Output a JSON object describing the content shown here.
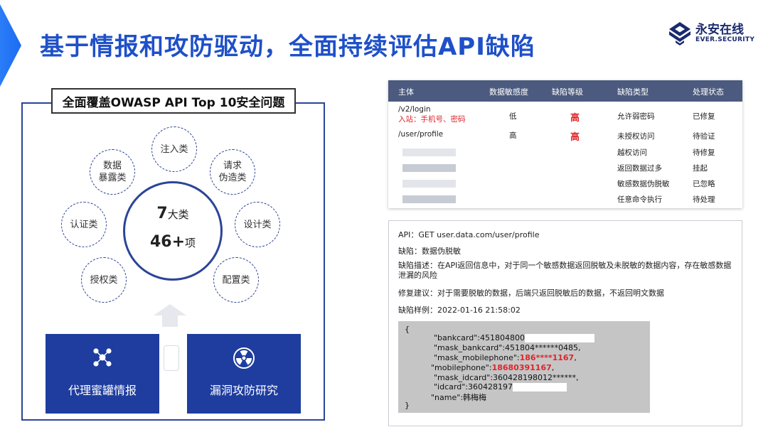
{
  "header": {
    "title": "基于情报和攻防驱动，全面持续评估API缺陷"
  },
  "logo": {
    "cn": "永安在线",
    "en": "EVER.SECURITY"
  },
  "left": {
    "owasp_label": "全面覆盖OWASP API Top 10安全问题",
    "center": {
      "count1": "7",
      "unit1": "大类",
      "count2": "46+",
      "unit2": "项"
    },
    "categories": [
      {
        "line1": "注入类",
        "line2": ""
      },
      {
        "line1": "请求",
        "line2": "伪造类"
      },
      {
        "line1": "设计类",
        "line2": ""
      },
      {
        "line1": "配置类",
        "line2": ""
      },
      {
        "line1": "授权类",
        "line2": ""
      },
      {
        "line1": "认证类",
        "line2": ""
      },
      {
        "line1": "数据",
        "line2": "暴露类"
      }
    ],
    "features": [
      {
        "label": "代理蜜罐情报",
        "icon": "network-nodes-icon"
      },
      {
        "label": "漏洞攻防研究",
        "icon": "radiation-icon"
      }
    ]
  },
  "table": {
    "headers": [
      "主体",
      "数据敏感度",
      "缺陷等级",
      "缺陷类型",
      "处理状态"
    ],
    "rows": [
      {
        "subject": "/v2/login",
        "subject_sub": "入站：手机号、密码",
        "sensitivity": "低",
        "level": "高",
        "type": "允许弱密码",
        "status": "已修复"
      },
      {
        "subject": "/user/profile",
        "subject_sub": "",
        "sensitivity": "高",
        "level": "高",
        "type": "未授权访问",
        "status": "待验证"
      },
      {
        "subject": "",
        "subject_sub": "",
        "sensitivity": "",
        "level": "",
        "type": "越权访问",
        "status": "待修复"
      },
      {
        "subject": "",
        "subject_sub": "",
        "sensitivity": "",
        "level": "",
        "type": "返回数据过多",
        "status": "挂起"
      },
      {
        "subject": "",
        "subject_sub": "",
        "sensitivity": "",
        "level": "",
        "type": "敏感数据伪脱敏",
        "status": "已忽略"
      },
      {
        "subject": "",
        "subject_sub": "",
        "sensitivity": "",
        "level": "",
        "type": "任意命令执行",
        "status": "待处理"
      }
    ]
  },
  "detail": {
    "api": "API：GET user.data.com/user/profile",
    "defect": "缺陷：数据伪脱敏",
    "description": "缺陷描述：在API返回信息中，对于同一个敏感数据返回脱敏及未脱敏的数据内容，存在敏感数据泄漏的风险",
    "suggestion": "修复建议：对于需要脱敏的数据，后端只返回脱敏后的数据，不返回明文数据",
    "sample": "缺陷样例：2022-01-16 21:58:02",
    "code": {
      "open": "{",
      "l1": "\"bankcard\":451804800",
      "l2": "\"mask_bankcard\":451804******0485,",
      "l3a": "\"mask_mobilephone\":",
      "l3b": "186****1167",
      "l3c": ",",
      "l4a": "\"mobilephone\":",
      "l4b": "18680391167",
      "l4c": ",",
      "l5": "\"mask_idcard\":360428198012******,",
      "l6": "\"idcard\":360428197",
      "l7": "\"name\":韩梅梅",
      "close": "}"
    }
  }
}
